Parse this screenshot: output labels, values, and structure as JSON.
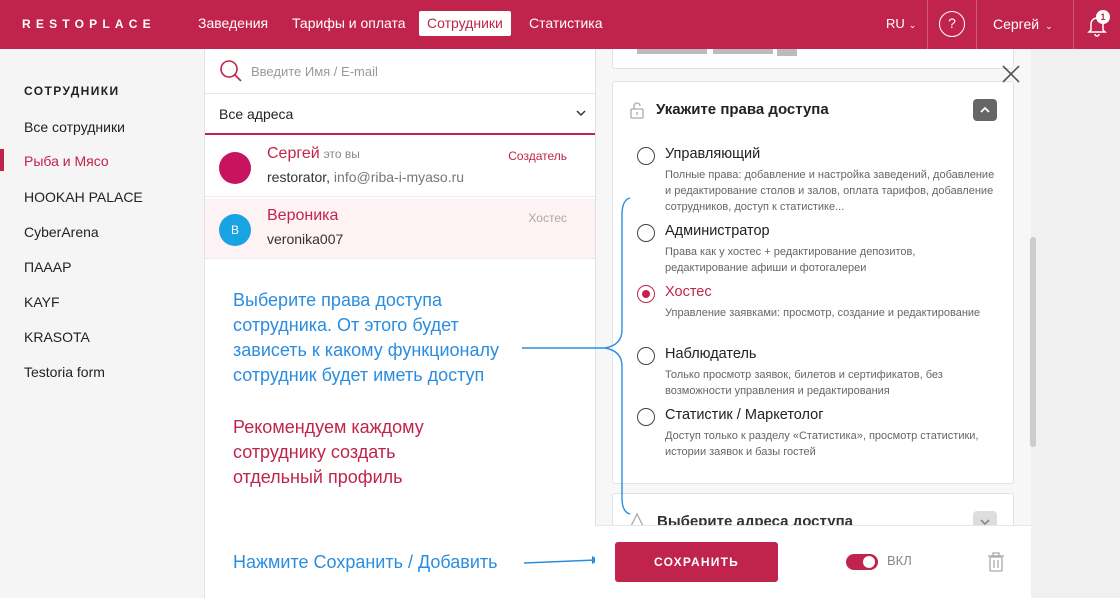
{
  "topbar": {
    "logo": "RESTOPLACE",
    "nav": [
      "Заведения",
      "Тарифы и оплата",
      "Сотрудники",
      "Статистика"
    ],
    "active_nav": "Сотрудники",
    "lang": "RU",
    "help_icon": "?",
    "user": "Сергей",
    "notification_count": "1",
    "accent": "#c0244d"
  },
  "sidebar": {
    "title": "СОТРУДНИКИ",
    "items": [
      "Все сотрудники",
      "Рыба и Мясо",
      "HOOKAH PALACE",
      "CyberArena",
      "ПААAP",
      "KAYF",
      "KRASOTA",
      "Testoria form"
    ],
    "active": "Рыба и Мясо"
  },
  "list": {
    "search_placeholder": "Введите Имя / E-mail",
    "address_filter": "Все адреса",
    "employees": [
      {
        "initial": "",
        "name": "Сергей",
        "you": "это вы",
        "login": "restorator,",
        "email": "info@riba-i-myaso.ru",
        "role": "Создатель",
        "avatar_color": "#c8145f"
      },
      {
        "initial": "В",
        "name": "Вероника",
        "you": "",
        "login": "veronika007",
        "email": "",
        "role": "Хостес",
        "avatar_color": "#1aa3e3"
      }
    ]
  },
  "hints": {
    "access_lines": [
      "Выберите права доступа",
      "сотрудника. От этого будет",
      "зависеть к какому функционалу",
      "сотрудник будет иметь доступ"
    ],
    "profile_lines": [
      "Рекомендуем каждому",
      "сотруднику создать",
      "отдельный профиль"
    ],
    "save_hint": "Нажмите Сохранить / Добавить"
  },
  "permissions": {
    "title": "Укажите права доступа",
    "roles": [
      {
        "name": "Управляющий",
        "desc": "Полные права: добавление и настройка заведений, добавление и редактирование столов и залов, оплата тарифов, добавление сотрудников, доступ к статистике...",
        "checked": false
      },
      {
        "name": "Администратор",
        "desc": "Права как у хостес + редактирование депозитов, редактирование афиши и фотогалереи",
        "checked": false
      },
      {
        "name": "Хостес",
        "desc": "Управление заявками: просмотр, создание и редактирование",
        "checked": true
      },
      {
        "name": "Наблюдатель",
        "desc": "Только просмотр заявок, билетов и сертификатов, без возможности управления и редактирования",
        "checked": false
      },
      {
        "name": "Статистик / Маркетолог",
        "desc": "Доступ только к разделу «Статистика», просмотр статистики, истории заявок и базы гостей",
        "checked": false
      }
    ],
    "addresses_title": "Выберите адреса доступа"
  },
  "footer": {
    "save_label": "СОХРАНИТЬ",
    "toggle_label": "ВКЛ",
    "toggle_on": true
  }
}
